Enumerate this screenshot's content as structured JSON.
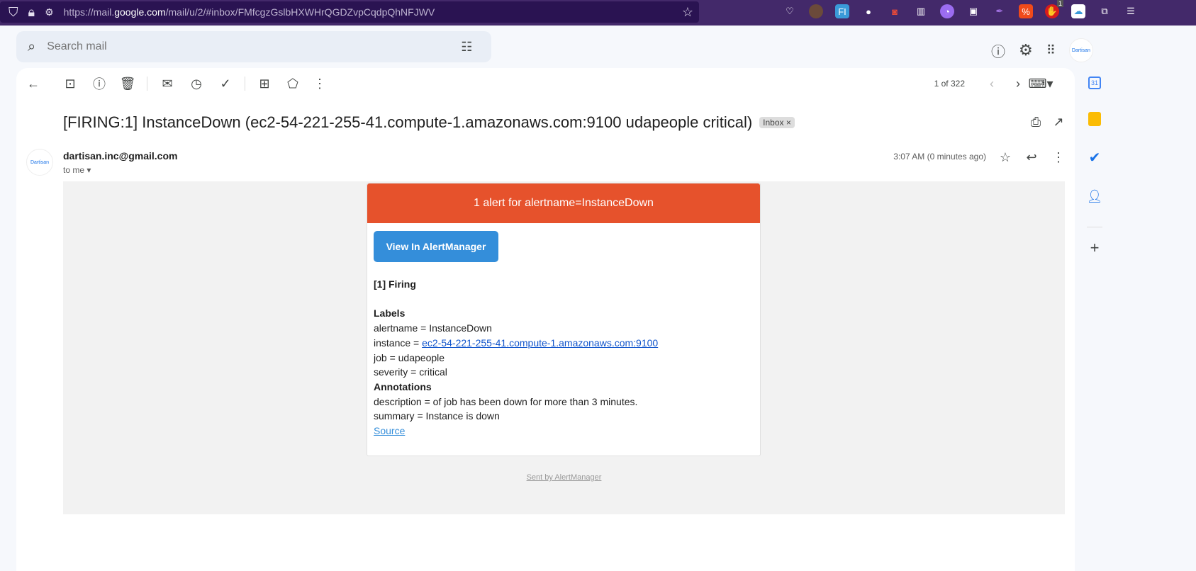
{
  "browser": {
    "url_prefix": "https://mail.",
    "url_domain": "google.com",
    "url_suffix": "/mail/u/2/#inbox/FMfcgzGslbHXWHrQGDZvpCqdpQhNFJWV",
    "ext_badge": "1"
  },
  "search": {
    "placeholder": "Search mail"
  },
  "toolbar": {
    "pager": "1 of 322"
  },
  "email": {
    "subject": "[FIRING:1] InstanceDown (ec2-54-221-255-41.compute-1.amazonaws.com:9100 udapeople critical)",
    "label": "Inbox",
    "label_close": "×",
    "sender": "dartisan.inc@gmail.com",
    "to": "to me",
    "time": "3:07 AM (0 minutes ago)"
  },
  "alert": {
    "header": "1 alert for alertname=InstanceDown",
    "button": "View In AlertManager",
    "firing": "[1] Firing",
    "labels_title": "Labels",
    "alertname": "alertname = InstanceDown",
    "instance_prefix": "instance = ",
    "instance_link": "ec2-54-221-255-41.compute-1.amazonaws.com:9100",
    "job": "job = udapeople",
    "severity": "severity = critical",
    "annotations_title": "Annotations",
    "description": "description = of job has been down for more than 3 minutes.",
    "summary": "summary = Instance is down",
    "source": "Source",
    "sent_by": "Sent by AlertManager"
  },
  "avatar_text": "Dartisan",
  "side": {
    "calendar_day": "31"
  }
}
